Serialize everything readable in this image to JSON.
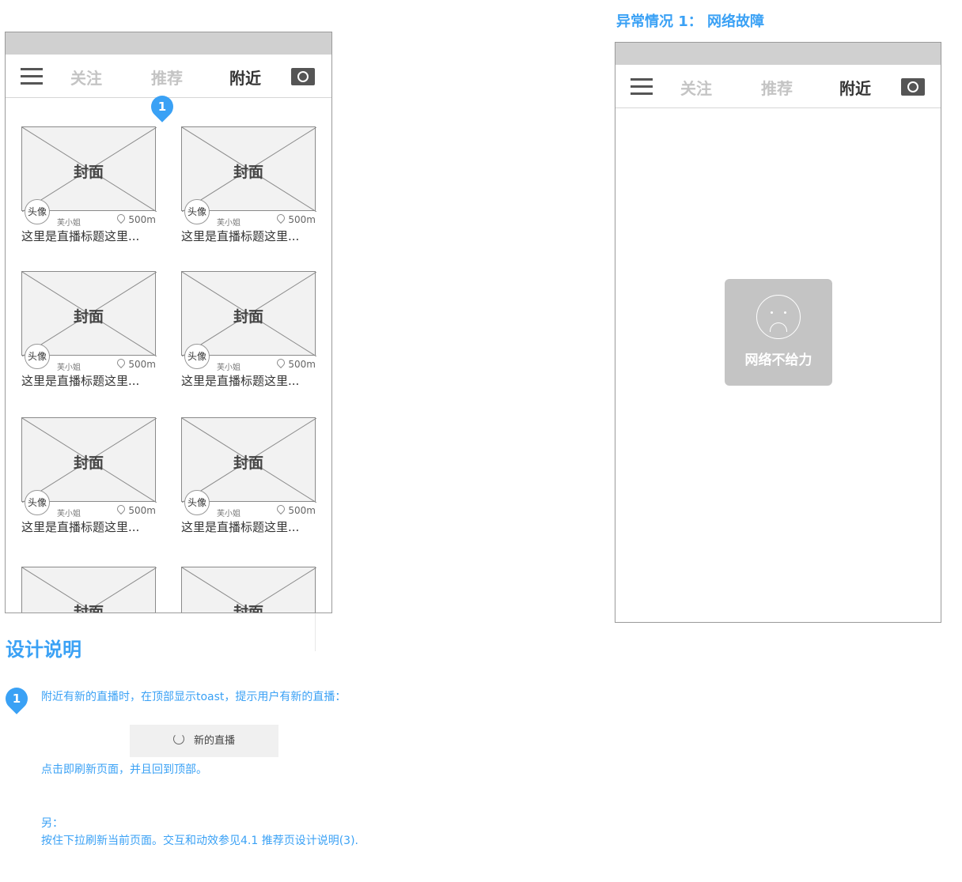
{
  "left_phone": {
    "tabs": {
      "follow": "关注",
      "recommend": "推荐",
      "nearby": "附近"
    },
    "toast_marker": "1",
    "cards": [
      {
        "cover": "封面",
        "avatar": "头像",
        "name": "芙小姐",
        "distance": "500m",
        "title": "这里是直播标题这里..."
      },
      {
        "cover": "封面",
        "avatar": "头像",
        "name": "芙小姐",
        "distance": "500m",
        "title": "这里是直播标题这里..."
      },
      {
        "cover": "封面",
        "avatar": "头像",
        "name": "芙小姐",
        "distance": "500m",
        "title": "这里是直播标题这里..."
      },
      {
        "cover": "封面",
        "avatar": "头像",
        "name": "芙小姐",
        "distance": "500m",
        "title": "这里是直播标题这里..."
      },
      {
        "cover": "封面",
        "avatar": "头像",
        "name": "芙小姐",
        "distance": "500m",
        "title": "这里是直播标题这里..."
      },
      {
        "cover": "封面",
        "avatar": "头像",
        "name": "芙小姐",
        "distance": "500m",
        "title": "这里是直播标题这里..."
      },
      {
        "cover": "封面"
      },
      {
        "cover": "封面"
      }
    ]
  },
  "design_notes": {
    "title": "设计说明",
    "marker": "1",
    "line1": "附近有新的直播时，在顶部显示toast，提示用户有新的直播：",
    "toast_label": "新的直播",
    "line2": "点击即刷新页面，并且回到顶部。",
    "line3": "另：",
    "line4": "按住下拉刷新当前页面。交互和动效参见4.1 推荐页设计说明(3)."
  },
  "abnormal": {
    "title": "异常情况 1： 网络故障",
    "tabs": {
      "follow": "关注",
      "recommend": "推荐",
      "nearby": "附近"
    },
    "error_text": "网络不给力"
  },
  "colors": {
    "accent": "#3aa1f5",
    "status_bar": "#d0d0d0",
    "error_toast": "#c4c4c4"
  },
  "icons": [
    "menu-icon",
    "camera-icon",
    "location-icon",
    "refresh-icon",
    "sad-face-icon"
  ]
}
